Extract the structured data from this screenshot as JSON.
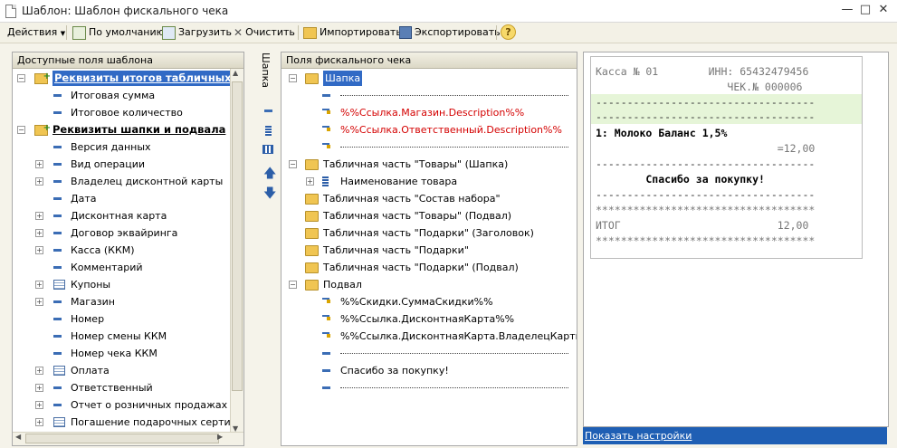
{
  "window": {
    "title": "Шаблон: Шаблон фискального чека"
  },
  "toolbar": {
    "actions": "Действия",
    "default": "По умолчанию",
    "load": "Загрузить",
    "clear": "Очистить",
    "import": "Импортировать",
    "export": "Экспортировать",
    "help": "?"
  },
  "left_panel": {
    "header": "Доступные поля шаблона",
    "items": [
      {
        "label": "Реквизиты итогов табличных частей"
      },
      {
        "label": "Итоговая сумма"
      },
      {
        "label": "Итоговое количество"
      },
      {
        "label": "Реквизиты шапки и подвала"
      },
      {
        "label": "Версия данных"
      },
      {
        "label": "Вид операции"
      },
      {
        "label": "Владелец дисконтной карты"
      },
      {
        "label": "Дата"
      },
      {
        "label": "Дисконтная карта"
      },
      {
        "label": "Договор эквайринга"
      },
      {
        "label": "Касса (ККМ)"
      },
      {
        "label": "Комментарий"
      },
      {
        "label": "Купоны"
      },
      {
        "label": "Магазин"
      },
      {
        "label": "Номер"
      },
      {
        "label": "Номер смены ККМ"
      },
      {
        "label": "Номер чека ККМ"
      },
      {
        "label": "Оплата"
      },
      {
        "label": "Ответственный"
      },
      {
        "label": "Отчет о розничных продажах"
      },
      {
        "label": "Погашение подарочных сертификатов"
      }
    ]
  },
  "side_toolbar": {
    "move_label": "Шапка"
  },
  "mid_panel": {
    "header": "Поля фискального чека",
    "items": [
      {
        "label": "Шапка"
      },
      {
        "label": ""
      },
      {
        "label": "%%Ссылка.Магазин.Description%%"
      },
      {
        "label": "%%Ссылка.Ответственный.Description%%"
      },
      {
        "label": ""
      },
      {
        "label": "Табличная часть \"Товары\" (Шапка)"
      },
      {
        "label": "Наименование товара"
      },
      {
        "label": "Табличная часть \"Состав набора\""
      },
      {
        "label": "Табличная часть \"Товары\" (Подвал)"
      },
      {
        "label": "Табличная часть \"Подарки\" (Заголовок)"
      },
      {
        "label": "Табличная часть \"Подарки\""
      },
      {
        "label": "Табличная часть \"Подарки\" (Подвал)"
      },
      {
        "label": "Подвал"
      },
      {
        "label": "%%Скидки.СуммаСкидки%%"
      },
      {
        "label": "%%Ссылка.ДисконтнаяКарта%%"
      },
      {
        "label": "%%Ссылка.ДисконтнаяКарта.ВладелецКарты%%"
      },
      {
        "label": ""
      },
      {
        "label": "Спасибо за покупку!"
      },
      {
        "label": ""
      }
    ]
  },
  "receipt": {
    "lines": [
      "Касса № 01        ИНН: 65432479456",
      "                     ЧЕК.№ 000006",
      "-----------------------------------",
      "-----------------------------------",
      "1: Молоко Баланс 1,5%",
      "                             =12,00",
      "-----------------------------------",
      "        Спасибо за покупку!",
      "-----------------------------------",
      "***********************************",
      "ИТОГ                         12,00",
      "***********************************"
    ]
  },
  "settings_link": "Показать настройки",
  "colors": {
    "selection": "#316ac5",
    "red_text": "#d40000",
    "highlight_row": "#e6f5d8"
  }
}
